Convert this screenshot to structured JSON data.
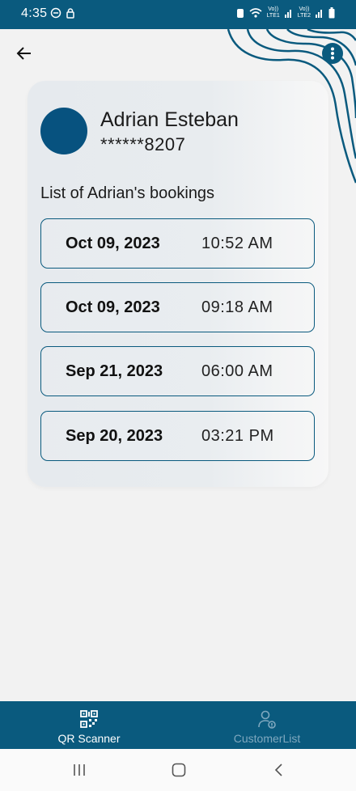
{
  "status_bar": {
    "time": "4:35",
    "network_1": "LTE1",
    "network_2": "LTE2",
    "volte": "Vo))"
  },
  "customer": {
    "name": "Adrian Esteban",
    "masked_phone": "******8207"
  },
  "bookings_heading": "List of Adrian's bookings",
  "bookings": [
    {
      "date": "Oct 09, 2023",
      "time": "10:52 AM"
    },
    {
      "date": "Oct 09, 2023",
      "time": "09:18 AM"
    },
    {
      "date": "Sep 21, 2023",
      "time": "06:00 AM"
    },
    {
      "date": "Sep 20, 2023",
      "time": "03:21 PM"
    }
  ],
  "bottom_nav": {
    "items": [
      {
        "label": "QR Scanner",
        "icon": "qr-code-icon",
        "active": true
      },
      {
        "label": "CustomerList",
        "icon": "customer-icon",
        "active": false
      }
    ]
  },
  "colors": {
    "brand": "#0a5a7e",
    "avatar": "#07527f",
    "inactive_nav": "#7fa8bf"
  },
  "icons": {
    "back": "arrow-left-icon",
    "menu": "more-vertical-icon",
    "system_recents": "recents-icon",
    "system_home": "home-icon",
    "system_back": "chevron-left-icon"
  }
}
